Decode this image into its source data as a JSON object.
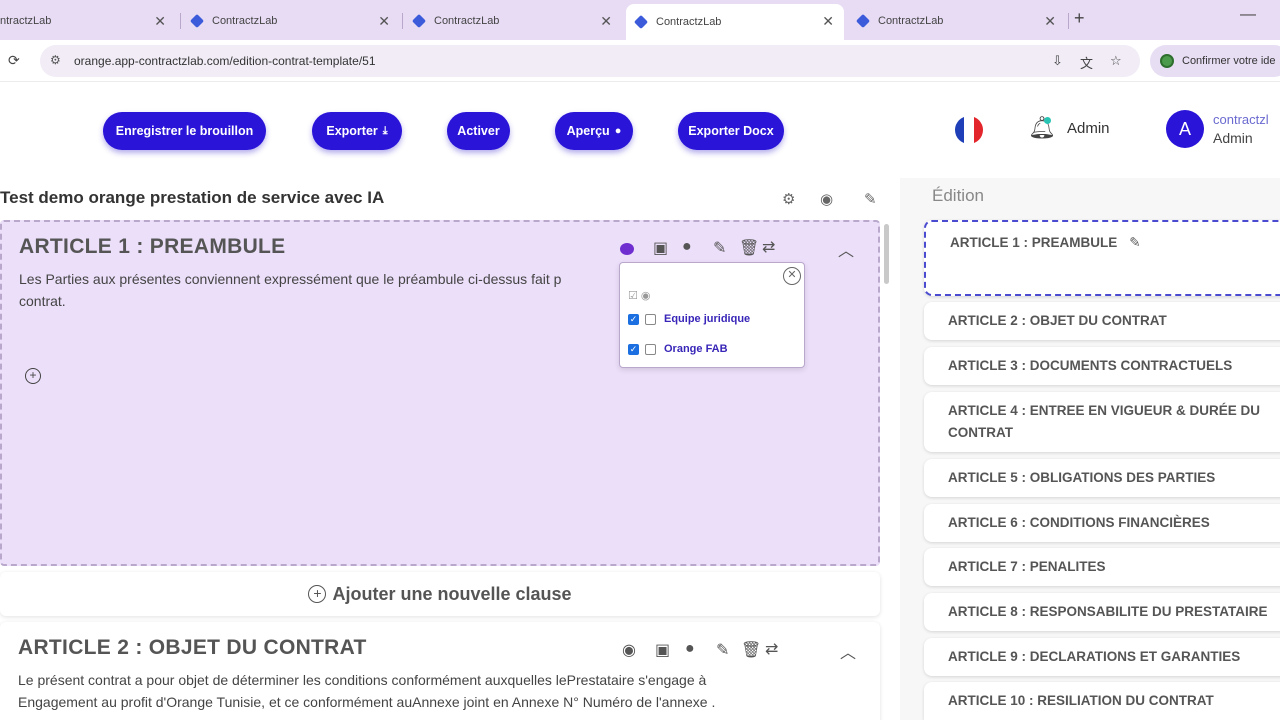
{
  "browser": {
    "tabs": [
      {
        "title": "ContractzLab"
      },
      {
        "title": "ContractzLab"
      },
      {
        "title": "ContractzLab"
      },
      {
        "title": "ContractzLab"
      },
      {
        "title": "ContractzLab"
      }
    ],
    "first_tab_title": "ntractzLab",
    "url": "orange.app-contractzlab.com/edition-contrat-template/51",
    "confirm_chip": "Confirmer votre ide"
  },
  "header": {
    "buttons": {
      "save_draft": "Enregistrer le brouillon",
      "export": "Exporter",
      "activate": "Activer",
      "preview": "Aperçu",
      "export_docx": "Exporter Docx"
    },
    "notifications_label": "Admin",
    "avatar_initial": "A",
    "user_name": "contractzl",
    "user_role": "Admin"
  },
  "document": {
    "title": "Test demo orange prestation de service avec IA",
    "article1": {
      "title": "ARTICLE 1 : PREAMBULE",
      "text_line1": "Les Parties aux présentes conviennent expressément que le préambule ci-dessus fait p",
      "text_line2": "contrat."
    },
    "visibility_popup": {
      "options": [
        {
          "label": "Equipe juridique",
          "checked": true
        },
        {
          "label": "Orange FAB",
          "checked": true
        }
      ]
    },
    "add_clause": "Ajouter une nouvelle clause",
    "article2": {
      "title": "ARTICLE 2 : OBJET DU CONTRAT",
      "text_line1": "Le présent contrat a pour objet de déterminer les conditions conformément auxquelles lePrestataire s'engage à",
      "text_line2": "Engagement au profit d'Orange Tunisie, et ce conformément auAnnexe joint en Annexe N° Numéro de l'annexe ."
    }
  },
  "edition_panel": {
    "title": "Édition",
    "articles": [
      "ARTICLE 1 : PREAMBULE",
      "ARTICLE 2 : OBJET DU CONTRAT",
      "ARTICLE 3 : DOCUMENTS CONTRACTUELS",
      "ARTICLE 4 : ENTREE EN VIGUEUR & DURÉE DU CONTRAT",
      "ARTICLE 5 : OBLIGATIONS DES PARTIES",
      "ARTICLE 6 : CONDITIONS FINANCIÈRES",
      "ARTICLE 7 : PENALITES",
      "ARTICLE 8 : RESPONSABILITE DU PRESTATAIRE",
      "ARTICLE 9 : DECLARATIONS ET GARANTIES",
      "ARTICLE 10 : RESILIATION DU CONTRAT"
    ]
  },
  "colors": {
    "accent": "#2914d8",
    "selected_article_bg": "#ecdffa",
    "tabstrip_bg": "#e8dcf5",
    "flag_blue": "#1f3fb8",
    "flag_red": "#e3262b"
  }
}
